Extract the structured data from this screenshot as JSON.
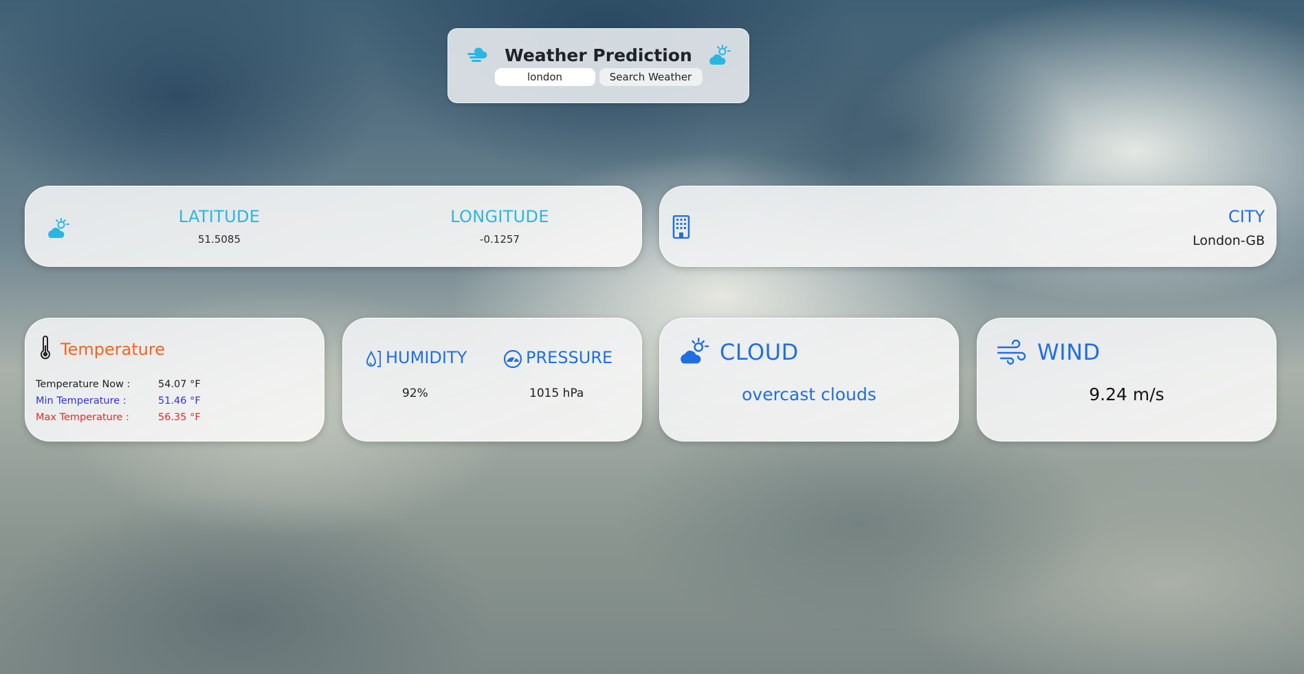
{
  "header": {
    "title": "Weather Prediction",
    "search_value": "london",
    "search_button_label": "Search Weather",
    "left_icon": "windy-cloud-icon",
    "right_icon": "sun-cloud-icon"
  },
  "coordinates": {
    "icon": "sun-cloud-icon",
    "latitude_label": "LATITUDE",
    "latitude_value": "51.5085",
    "longitude_label": "LONGITUDE",
    "longitude_value": "-0.1257"
  },
  "city": {
    "icon": "building-icon",
    "label": "CITY",
    "value": "London-GB"
  },
  "temperature": {
    "icon": "thermometer-icon",
    "title": "Temperature",
    "now_label": "Temperature Now :",
    "now_value": "54.07 °F",
    "min_label": "Min Temperature :",
    "min_value": "51.46 °F",
    "max_label": "Max Temperature :",
    "max_value": "56.35 °F"
  },
  "humidity_pressure": {
    "humidity_icon": "droplet-icon",
    "humidity_label": "HUMIDITY",
    "humidity_value": "92%",
    "pressure_icon": "gauge-icon",
    "pressure_label": "PRESSURE",
    "pressure_value": "1015 hPa"
  },
  "cloud": {
    "icon": "sun-cloud-icon",
    "label": "CLOUD",
    "description": "overcast clouds"
  },
  "wind": {
    "icon": "wind-icon",
    "label": "WIND",
    "value": "9.24 m/s"
  },
  "colors": {
    "accent_cyan": "#29b6e3",
    "accent_blue": "#1f6fe0",
    "temperature_orange": "#f0671a",
    "min_blue": "#2e32d8",
    "max_red": "#e8262a"
  }
}
